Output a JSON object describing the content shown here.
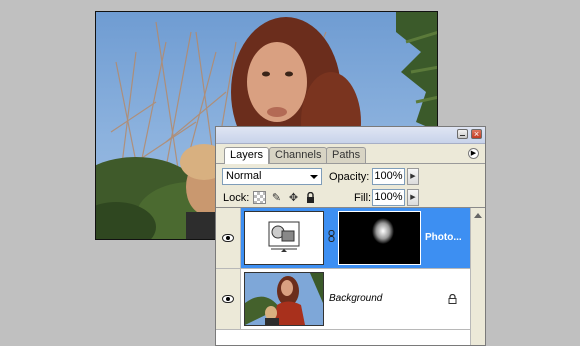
{
  "palette": {
    "tabs": [
      {
        "label": "Layers",
        "active": true
      },
      {
        "label": "Channels",
        "active": false
      },
      {
        "label": "Paths",
        "active": false
      }
    ],
    "blend_mode": "Normal",
    "opacity_label": "Opacity:",
    "opacity_value": "100%",
    "lock_label": "Lock:",
    "fill_label": "Fill:",
    "fill_value": "100%"
  },
  "layers": [
    {
      "name": "Photo...",
      "selected": true,
      "has_mask": true
    },
    {
      "name": "Background",
      "selected": false,
      "locked": true
    }
  ],
  "colors": {
    "selection": "#3d8ff2",
    "panel_bg": "#ece9d8",
    "sky": "#7ea7d8"
  },
  "icons": [
    "minimize-icon",
    "close-icon",
    "palette-menu-icon",
    "lock-transparent-icon",
    "lock-brush-icon",
    "lock-move-icon",
    "lock-all-icon",
    "eye-icon",
    "link-icon",
    "layer-lock-icon"
  ]
}
